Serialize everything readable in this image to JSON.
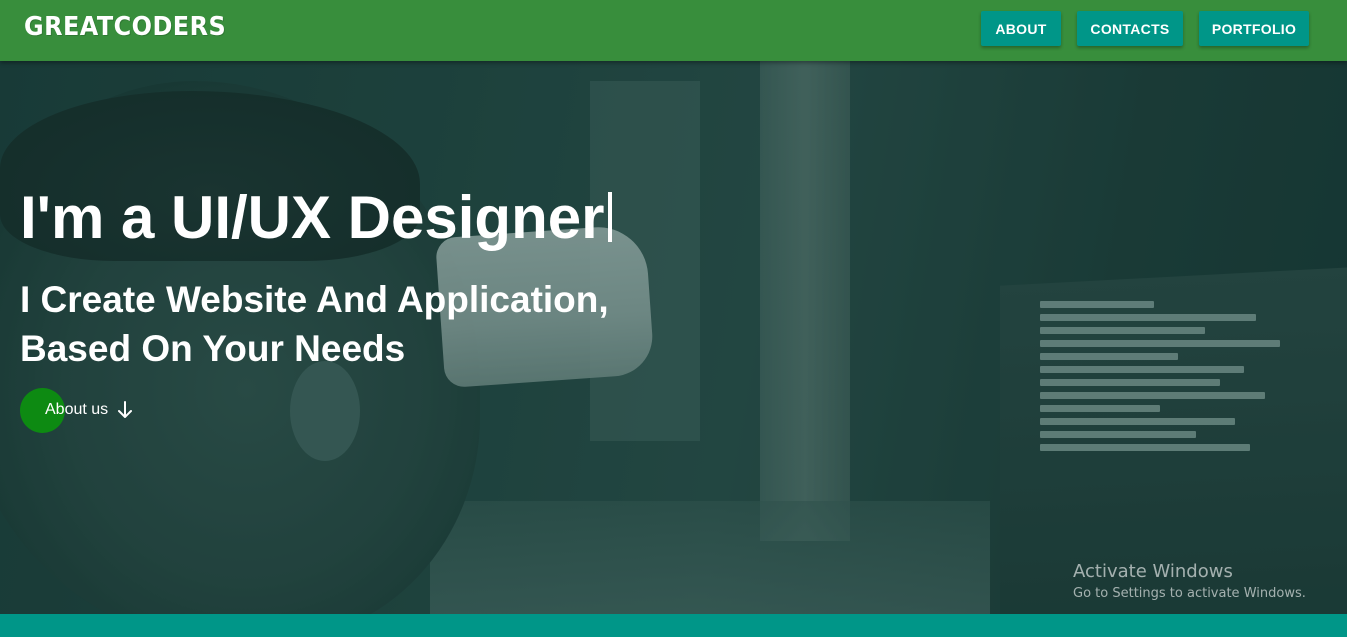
{
  "header": {
    "logo": "GREATCODERS",
    "nav": {
      "about": "ABOUT",
      "contacts": "CONTACTS",
      "portfolio": "PORTFOLIO"
    }
  },
  "hero": {
    "title": "I'm a UI/UX Designer",
    "subtitle_line1": "I Create Website And Application,",
    "subtitle_line2": "Based On Your Needs",
    "cta_label": "About us",
    "cta_icon": "arrow-down-icon"
  },
  "watermark": {
    "title": "Activate Windows",
    "subtitle": "Go to Settings to activate Windows."
  },
  "colors": {
    "header_bg": "#388e3c",
    "nav_button_bg": "#009688",
    "cta_dot": "#0d8a12",
    "bottom_strip": "#009688"
  }
}
